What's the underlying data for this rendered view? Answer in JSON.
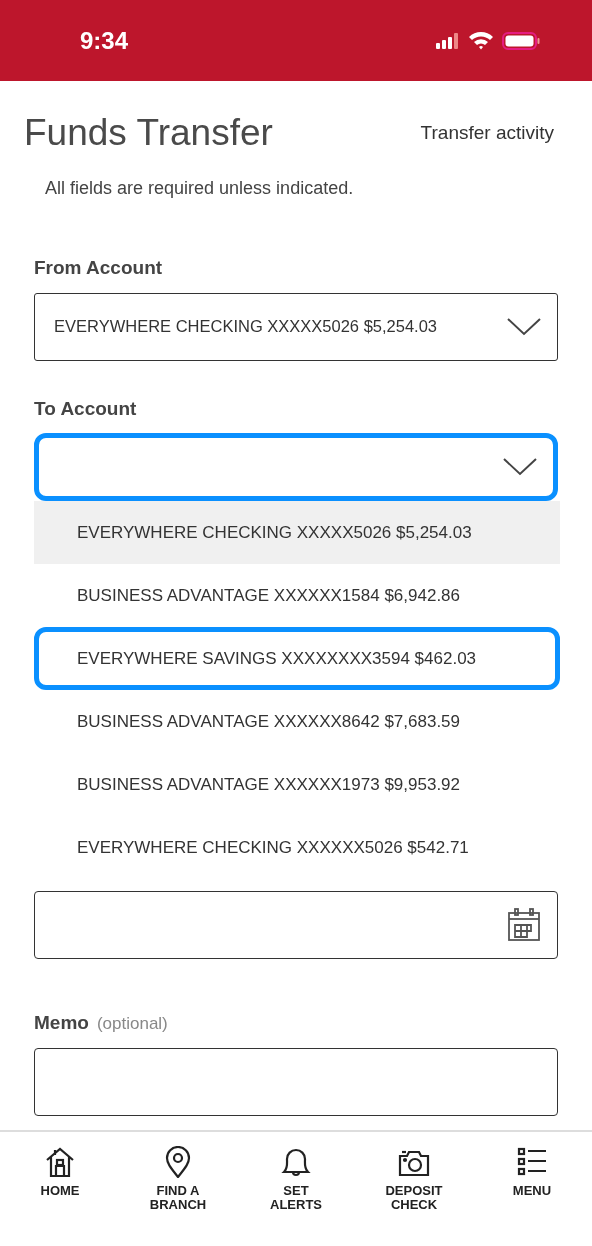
{
  "status_bar": {
    "time": "9:34"
  },
  "header": {
    "title": "Funds Transfer",
    "link": "Transfer activity"
  },
  "note": "All fields are required unless indicated.",
  "from_account": {
    "label": "From Account",
    "value": "EVERYWHERE CHECKING XXXXX5026 $5,254.03",
    "focused": false
  },
  "to_account": {
    "label": "To Account",
    "focused": true,
    "options": [
      {
        "text": "EVERYWHERE CHECKING XXXXX5026 $5,254.03",
        "highlighted": true,
        "focused": false
      },
      {
        "text": "BUSINESS ADVANTAGE XXXXXX1584 $6,942.86",
        "highlighted": false,
        "focused": false
      },
      {
        "text": "EVERYWHERE SAVINGS XXXXXXXX3594 $462.03",
        "highlighted": false,
        "focused": true
      },
      {
        "text": "BUSINESS ADVANTAGE XXXXXX8642 $7,683.59",
        "highlighted": false,
        "focused": false
      },
      {
        "text": "BUSINESS ADVANTAGE XXXXXX1973 $9,953.92",
        "highlighted": false,
        "focused": false
      },
      {
        "text": "EVERYWHERE CHECKING XXXXXX5026 $542.71",
        "highlighted": false,
        "focused": false
      }
    ]
  },
  "memo": {
    "label": "Memo",
    "hint": "(optional)"
  },
  "bottom_nav": [
    {
      "kind": "home",
      "label": "HOME"
    },
    {
      "kind": "pin",
      "label": "FIND A BRANCH"
    },
    {
      "kind": "bell",
      "label": "SET ALERTS"
    },
    {
      "kind": "camera",
      "label": "DEPOSIT CHECK"
    },
    {
      "kind": "list",
      "label": "MENU"
    }
  ]
}
